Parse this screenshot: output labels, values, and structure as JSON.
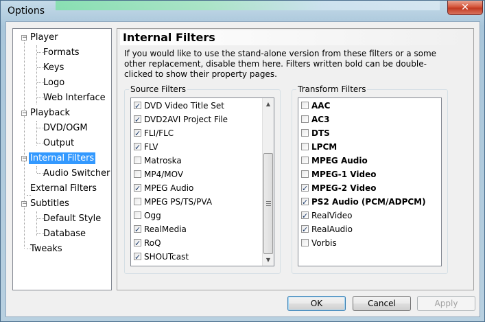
{
  "window": {
    "title": "Options",
    "close_glyph": "✕"
  },
  "tree": {
    "items": [
      {
        "label": "Player"
      },
      {
        "label": "Formats"
      },
      {
        "label": "Keys"
      },
      {
        "label": "Logo"
      },
      {
        "label": "Web Interface"
      },
      {
        "label": "Playback"
      },
      {
        "label": "DVD/OGM"
      },
      {
        "label": "Output"
      },
      {
        "label": "Internal Filters"
      },
      {
        "label": "Audio Switcher"
      },
      {
        "label": "External Filters"
      },
      {
        "label": "Subtitles"
      },
      {
        "label": "Default Style"
      },
      {
        "label": "Database"
      },
      {
        "label": "Tweaks"
      }
    ],
    "expander": "−"
  },
  "panel": {
    "title": "Internal Filters",
    "description": "If you would like to use the stand-alone version from these filters or a some other replacement, disable them here. Filters written bold can be double-clicked to show their property pages."
  },
  "source_filters": {
    "label": "Source Filters",
    "items": [
      {
        "label": "DVD Video Title Set",
        "checked": true
      },
      {
        "label": "DVD2AVI Project File",
        "checked": true
      },
      {
        "label": "FLI/FLC",
        "checked": true
      },
      {
        "label": "FLV",
        "checked": true
      },
      {
        "label": "Matroska",
        "checked": false
      },
      {
        "label": "MP4/MOV",
        "checked": false
      },
      {
        "label": "MPEG Audio",
        "checked": true
      },
      {
        "label": "MPEG PS/TS/PVA",
        "checked": false
      },
      {
        "label": "Ogg",
        "checked": false
      },
      {
        "label": "RealMedia",
        "checked": true
      },
      {
        "label": "RoQ",
        "checked": true
      },
      {
        "label": "SHOUTcast",
        "checked": true
      }
    ],
    "scroll_up": "▲",
    "scroll_down": "▼"
  },
  "transform_filters": {
    "label": "Transform Filters",
    "items": [
      {
        "label": "AAC",
        "checked": false,
        "bold": true
      },
      {
        "label": "AC3",
        "checked": false,
        "bold": true
      },
      {
        "label": "DTS",
        "checked": false,
        "bold": true
      },
      {
        "label": "LPCM",
        "checked": false,
        "bold": true
      },
      {
        "label": "MPEG Audio",
        "checked": false,
        "bold": true
      },
      {
        "label": "MPEG-1 Video",
        "checked": false,
        "bold": true
      },
      {
        "label": "MPEG-2 Video",
        "checked": true,
        "bold": true
      },
      {
        "label": "PS2 Audio (PCM/ADPCM)",
        "checked": true,
        "bold": true
      },
      {
        "label": "RealVideo",
        "checked": true,
        "bold": false
      },
      {
        "label": "RealAudio",
        "checked": true,
        "bold": false
      },
      {
        "label": "Vorbis",
        "checked": false,
        "bold": false
      }
    ]
  },
  "buttons": {
    "ok": "OK",
    "cancel": "Cancel",
    "apply": "Apply"
  }
}
